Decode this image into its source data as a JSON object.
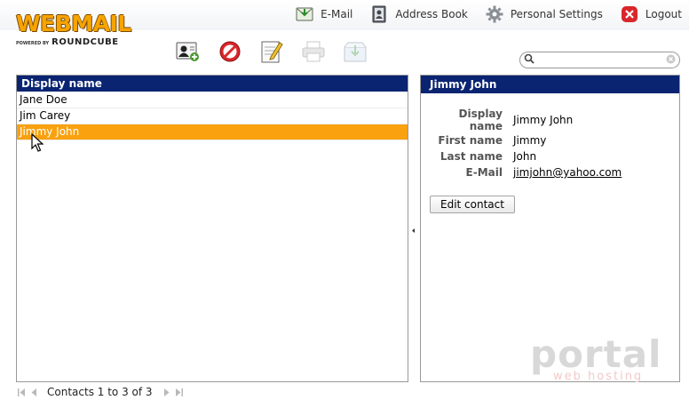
{
  "app": {
    "logo_main": "WEBMAIL",
    "logo_powered": "POWERED BY",
    "logo_brand": "ROUNDCUBE"
  },
  "topnav": [
    {
      "label": "E-Mail",
      "icon": "mail-download-icon"
    },
    {
      "label": "Address Book",
      "icon": "address-book-icon"
    },
    {
      "label": "Personal Settings",
      "icon": "gear-icon"
    },
    {
      "label": "Logout",
      "icon": "logout-icon"
    }
  ],
  "toolbar": [
    {
      "name": "add-contact",
      "icon": "add-contact-icon",
      "enabled": true
    },
    {
      "name": "delete-contact",
      "icon": "delete-icon",
      "enabled": true
    },
    {
      "name": "compose-to-contact",
      "icon": "compose-icon",
      "enabled": true
    },
    {
      "name": "print",
      "icon": "printer-icon",
      "enabled": false
    },
    {
      "name": "export",
      "icon": "export-icon",
      "enabled": false
    }
  ],
  "search": {
    "placeholder": "",
    "value": ""
  },
  "contact_list": {
    "header": "Display name",
    "rows": [
      "Jane Doe",
      "Jim Carey",
      "Jimmy John"
    ],
    "selected_index": 2
  },
  "contact_detail": {
    "header": "Jimmy John",
    "fields": [
      {
        "label": "Display name",
        "value": "Jimmy John"
      },
      {
        "label": "First name",
        "value": "Jimmy"
      },
      {
        "label": "Last name",
        "value": "John"
      },
      {
        "label": "E-Mail",
        "value": "jimjohn@yahoo.com"
      }
    ],
    "edit_button": "Edit contact"
  },
  "footer": {
    "count_text": "Contacts 1 to 3 of 3"
  },
  "watermark": {
    "main": "portal",
    "sub": "web hosting"
  },
  "colors": {
    "header_bg": "#0a2472",
    "selected_row": "#f9a10f",
    "logo_orange": "#f7a400"
  }
}
